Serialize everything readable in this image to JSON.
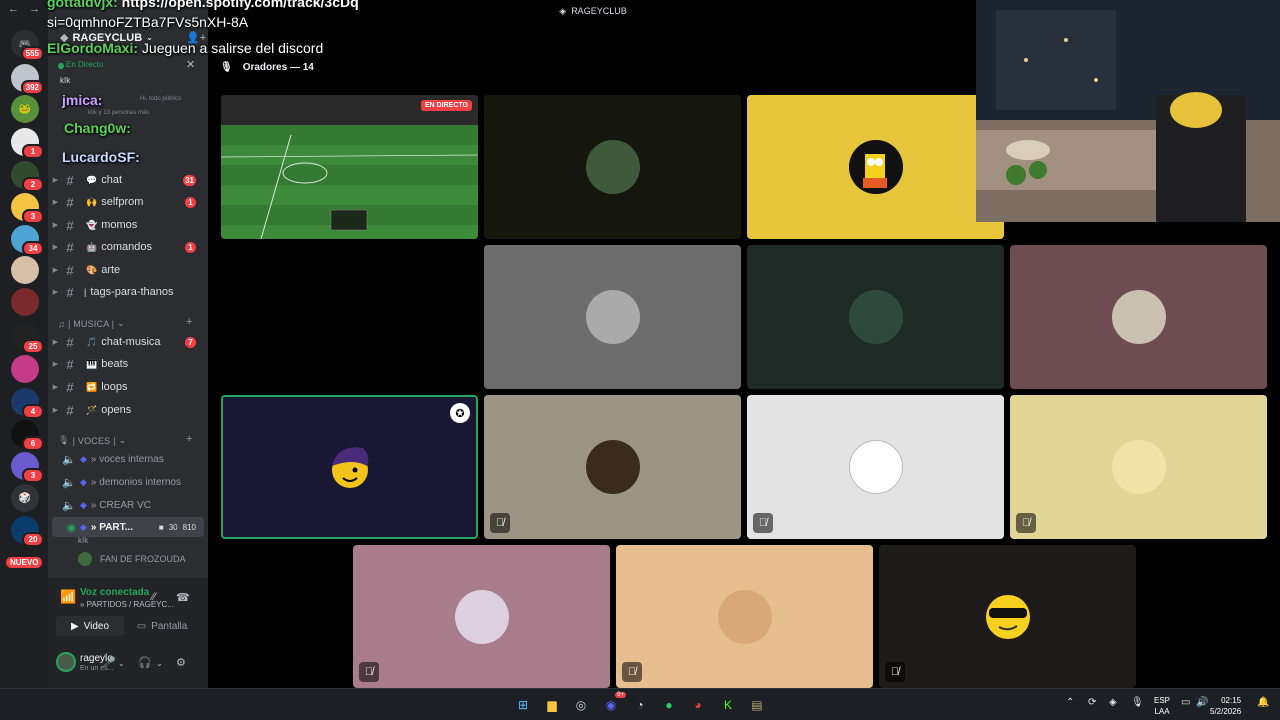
{
  "overlay_chat": {
    "line1_user": "gottaldvjx:",
    "line1_text": " https://open.spotify.com/track/3cDq",
    "line2_text": "si=0qmhnoFZTBa7FVs5nXH-8A",
    "line3_user": "ElGordoMaxi:",
    "line3_text": " Jueguen a salirse del discord",
    "name1": "jmica:",
    "name2": "Chang0w:",
    "name3": "LucardoSF:"
  },
  "rail": {
    "badge_top": "555",
    "badges": [
      "392",
      "1",
      "2",
      "3",
      "34",
      "25",
      "4",
      "6",
      "3",
      "20"
    ],
    "new_label": "NUEVO"
  },
  "sidebar": {
    "server_name": "RAGEYCLUB",
    "live_label": "En Directo",
    "live_user": "kIk",
    "live_sub": "kIik y 13 personas más",
    "live_public": "Hi, todo público",
    "channels": [
      {
        "emoji": "💬",
        "name": "chat",
        "badge": "31"
      },
      {
        "emoji": "🙌",
        "name": "selfprom",
        "badge": "1"
      },
      {
        "emoji": "👻",
        "name": "momos",
        "badge": ""
      },
      {
        "emoji": "🤖",
        "name": "comandos",
        "badge": "1"
      },
      {
        "emoji": "🎨",
        "name": "arte",
        "badge": ""
      },
      {
        "emoji": "",
        "name": "tags-para-thanos",
        "badge": ""
      }
    ],
    "music_category": "| MUSICA |",
    "music_channels": [
      {
        "emoji": "🎵",
        "name": "chat-musica",
        "badge": "7"
      },
      {
        "emoji": "🎹",
        "name": "beats",
        "badge": ""
      },
      {
        "emoji": "🔁",
        "name": "loops",
        "badge": ""
      },
      {
        "emoji": "🪄",
        "name": "opens",
        "badge": ""
      }
    ],
    "voice_category": "| VOCES |",
    "voice_channels": [
      {
        "name": "» voces internas"
      },
      {
        "name": "» demonios internos"
      },
      {
        "name": "» CREAR VC"
      }
    ],
    "active_voice": {
      "name": "» PART...",
      "cams": "30",
      "count": "810"
    },
    "active_voice_user": "kIk",
    "fan_item": "FAN DE FROZOUDA",
    "voice_status": "Voz conectada",
    "voice_path": "» PARTIDOS / RAGEYC...",
    "video_label": "Video",
    "screen_label": "Pantalla",
    "username": "rageylo",
    "user_status": "En un es..."
  },
  "stage": {
    "window_title": "RAGEYCLUB",
    "speakers_label": "Oradores — 14",
    "live_tag": "EN DIRECTO"
  },
  "taskbar": {
    "lang_top": "ESP",
    "lang_bottom": "LAA",
    "time": "02:15",
    "date": "5/2/2026",
    "discord_badge": "9+"
  }
}
